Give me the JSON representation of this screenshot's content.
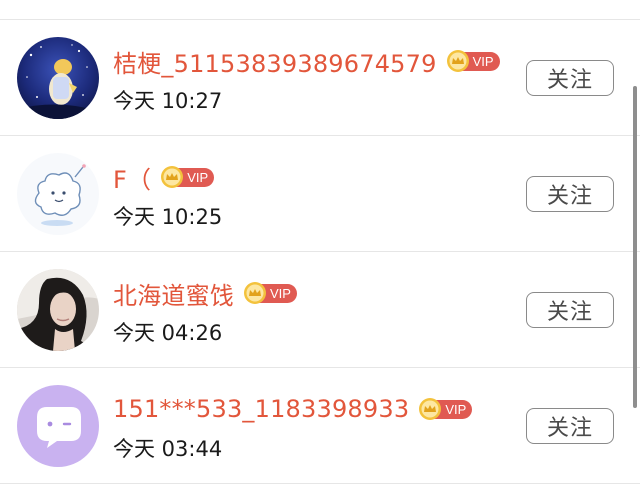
{
  "follow_label": "关注",
  "vip_label": "VIP",
  "colors": {
    "username": "#e2563b",
    "vip_badge": "#e05a52",
    "crown": "#f3c23c",
    "divider": "#e6e6e6"
  },
  "users": [
    {
      "name": "桔梗_51153839389674579",
      "time": "今天 10:27",
      "avatar": "night-sky-avatar"
    },
    {
      "name": "F（",
      "time": "今天 10:25",
      "avatar": "sketch-sheep-avatar"
    },
    {
      "name": "北海道蜜饯",
      "time": "今天 04:26",
      "avatar": "girl-portrait-avatar"
    },
    {
      "name": "151***533_1183398933",
      "time": "今天 03:44",
      "avatar": "default-chat-avatar"
    }
  ]
}
